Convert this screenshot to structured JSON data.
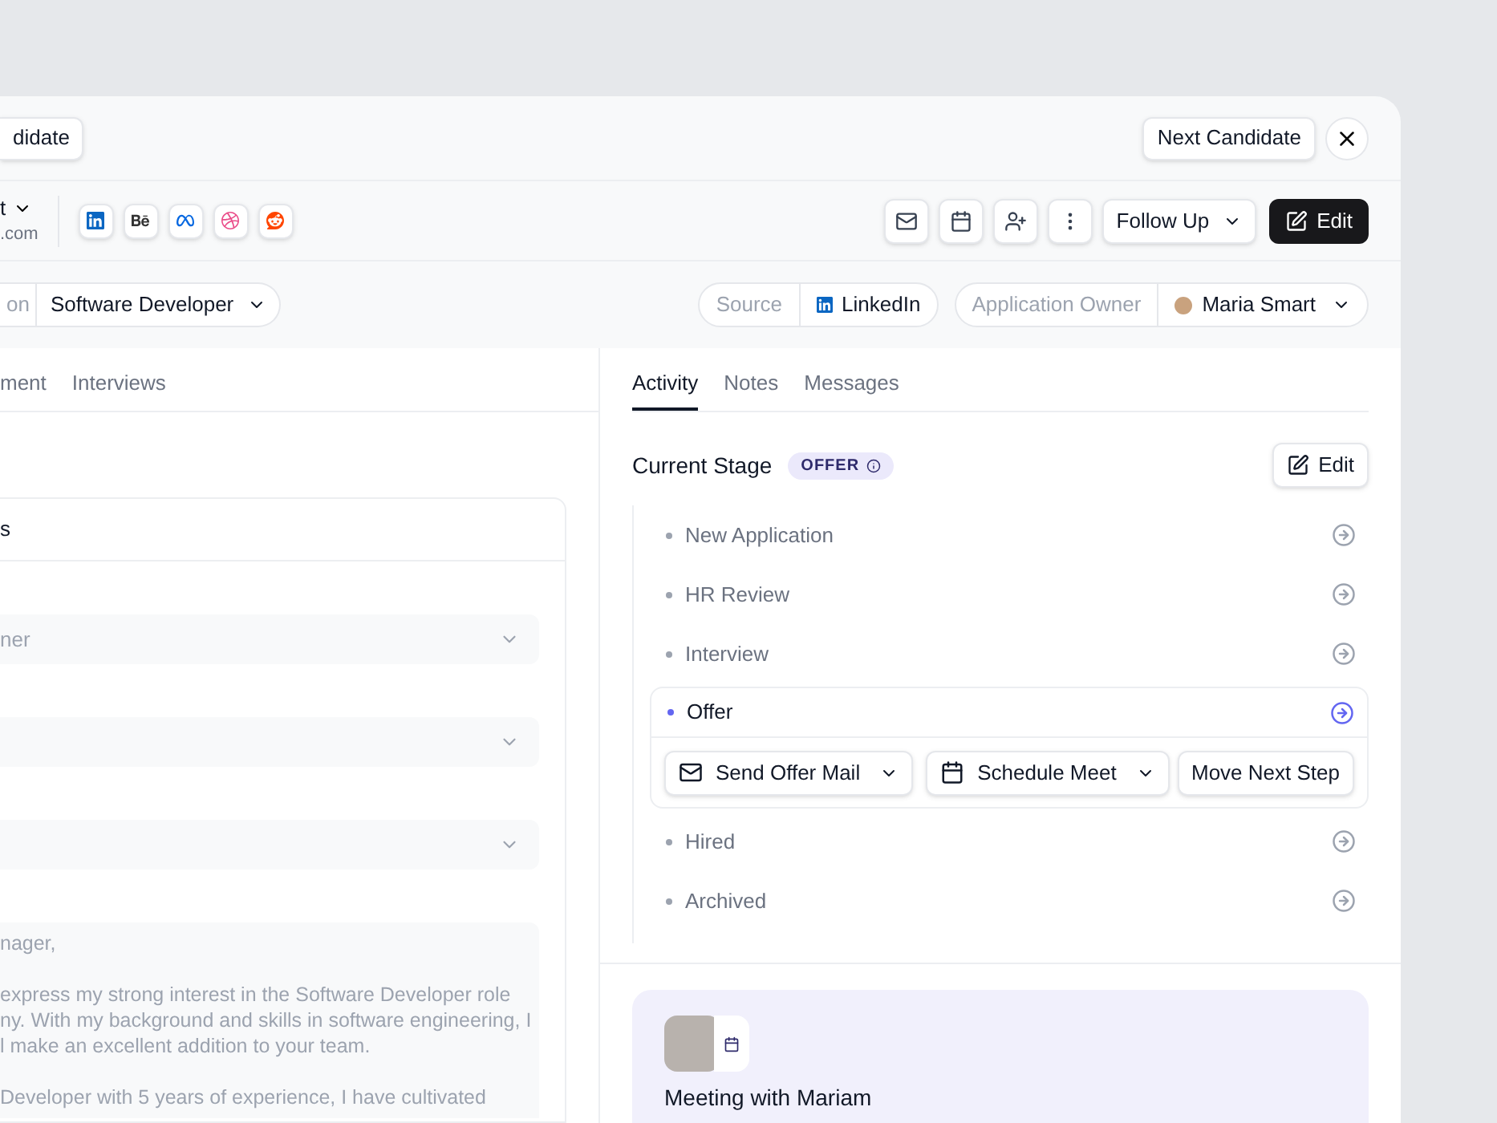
{
  "header": {
    "prev_button": "didate",
    "next_button": "Next Candidate"
  },
  "candidate": {
    "name": "t",
    "email": ".com"
  },
  "toolbar": {
    "follow_up": "Follow Up",
    "edit": "Edit"
  },
  "fields": {
    "position_label": "on",
    "position_value": "Software Developer",
    "source_label": "Source",
    "source_value": "LinkedIn",
    "owner_label": "Application Owner",
    "owner_value": "Maria Smart"
  },
  "left_tabs": [
    {
      "label": "ment",
      "selected": false
    },
    {
      "label": "Interviews",
      "selected": false
    }
  ],
  "left_card": {
    "title": "s",
    "selects": [
      {
        "kind": "dropdown",
        "placeholder": "ner"
      },
      {
        "kind": "dropdown"
      },
      {
        "kind": "dropdown"
      }
    ],
    "letter_lines": [
      "nager,",
      "express my strong interest in the Software Developer role",
      "ny. With my background and skills in software engineering, I",
      "l make an excellent addition to your team.",
      "Developer with 5 years of experience, I have cultivated"
    ]
  },
  "right_tabs": [
    {
      "label": "Activity",
      "selected": true
    },
    {
      "label": "Notes",
      "selected": false
    },
    {
      "label": "Messages",
      "selected": false
    }
  ],
  "current_stage": {
    "title": "Current Stage",
    "badge": "OFFER",
    "edit": "Edit"
  },
  "stages": [
    {
      "label": "New Application",
      "selected": false
    },
    {
      "label": "HR Review",
      "selected": false
    },
    {
      "label": "Interview",
      "selected": false
    },
    {
      "label": "Offer",
      "selected": true,
      "actions": [
        {
          "label": "Send Offer Mail",
          "kind": "dropdown"
        },
        {
          "label": "Schedule Meet",
          "kind": "dropdown"
        },
        {
          "label": "Move Next Step",
          "kind": "button"
        }
      ]
    },
    {
      "label": "Hired",
      "selected": false
    },
    {
      "label": "Archived",
      "selected": false
    }
  ],
  "meeting": {
    "title": "Meeting with Mariam"
  }
}
